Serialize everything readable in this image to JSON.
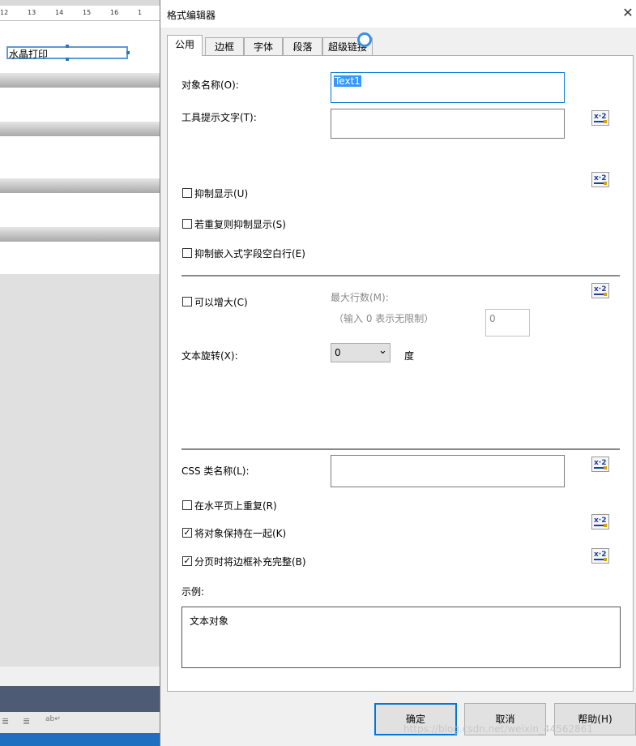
{
  "background": {
    "ruler_ticks": [
      "12",
      "13",
      "14",
      "15",
      "16",
      "1"
    ],
    "field_text": "水晶打印",
    "toolbar_glyphs": [
      "≣",
      "≣",
      "ab↵"
    ]
  },
  "dialog": {
    "title": "格式编辑器",
    "close_glyph": "✕",
    "tabs": [
      {
        "label": "公用",
        "active": true
      },
      {
        "label": "边框",
        "active": false
      },
      {
        "label": "字体",
        "active": false
      },
      {
        "label": "段落",
        "active": false
      },
      {
        "label": "超级链接",
        "active": false
      }
    ],
    "object_name_label": "对象名称(O):",
    "object_name_value": "Text1",
    "tooltip_label": "工具提示文字(T):",
    "tooltip_value": "",
    "suppress": {
      "label": "抑制显示(U)",
      "checked": false
    },
    "suppress_duplicates": {
      "label": "若重复则抑制显示(S)",
      "checked": false
    },
    "suppress_blank": {
      "label": "抑制嵌入式字段空白行(E)",
      "checked": false
    },
    "can_grow": {
      "label": "可以增大(C)",
      "checked": false
    },
    "max_lines_label": "最大行数(M):",
    "max_lines_hint": "（输入 0 表示无限制）",
    "max_lines_value": "0",
    "rotation_label": "文本旋转(X):",
    "rotation_value": "0",
    "rotation_unit": "度",
    "css_label": "CSS 类名称(L):",
    "css_value": "",
    "repeat_horizontal": {
      "label": "在水平页上重复(R)",
      "checked": false
    },
    "keep_together": {
      "label": "将对象保持在一起(K)",
      "checked": true
    },
    "close_border": {
      "label": "分页时将边框补充完整(B)",
      "checked": true
    },
    "sample_label": "示例:",
    "sample_text": "文本对象",
    "formula_button_label": "x·2",
    "buttons": {
      "ok": "确定",
      "cancel": "取消",
      "help": "帮助(H)"
    },
    "check_glyph": "✓",
    "dropdown_glyph": "⌄"
  },
  "watermark": "https://blog.csdn.net/weixin_44562861",
  "colors": {
    "accent": "#0078d7",
    "selection": "#3399ff",
    "field_border": "#5b9bd5"
  }
}
